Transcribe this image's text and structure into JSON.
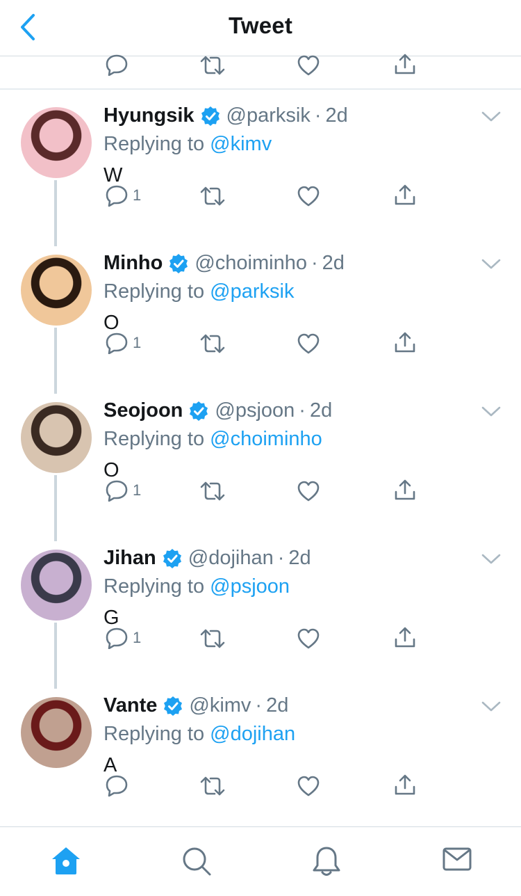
{
  "header": {
    "title": "Tweet",
    "back_icon": "chevron-left-icon"
  },
  "colors": {
    "accent": "#1da1f2",
    "muted": "#657786",
    "text": "#14171a",
    "border": "#e6ecf0"
  },
  "tweets": [
    {
      "name": "Hyungsik",
      "handle": "@parksik",
      "time": "2d",
      "reply_prefix": "Replying to",
      "reply_to": "@kimv",
      "text": "W",
      "replies": "1"
    },
    {
      "name": "Minho",
      "handle": "@choiminho",
      "time": "2d",
      "reply_prefix": "Replying to",
      "reply_to": "@parksik",
      "text": "O",
      "replies": "1"
    },
    {
      "name": "Seojoon",
      "handle": "@psjoon",
      "time": "2d",
      "reply_prefix": "Replying to",
      "reply_to": "@choiminho",
      "text": "O",
      "replies": "1"
    },
    {
      "name": "Jihan",
      "handle": "@dojihan",
      "time": "2d",
      "reply_prefix": "Replying to",
      "reply_to": "@psjoon",
      "text": "G",
      "replies": "1"
    },
    {
      "name": "Vante",
      "handle": "@kimv",
      "time": "2d",
      "reply_prefix": "Replying to",
      "reply_to": "@dojihan",
      "text": "A",
      "replies": ""
    }
  ],
  "tabbar": {
    "items": [
      "home-icon",
      "search-icon",
      "notifications-icon",
      "messages-icon"
    ],
    "active": "home-icon"
  }
}
